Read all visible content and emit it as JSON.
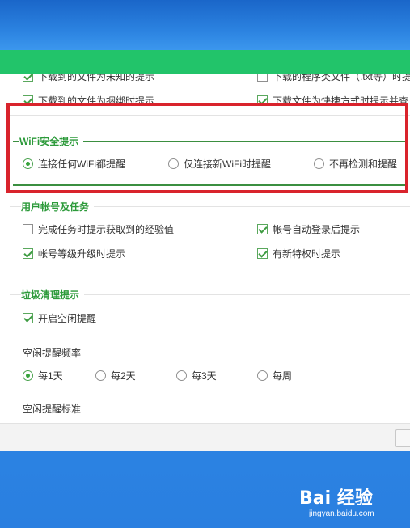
{
  "partial_rows": {
    "top_left": "下载到的文件为未知的提示",
    "top_right": "下载的程序类文件（.txt等）时提",
    "row2_left": "下载到的文件为捆绑时提示",
    "row2_right": "下载文件为快捷方式时提示并查"
  },
  "wifi": {
    "title": "WiFi安全提示",
    "options": [
      "连接任何WiFi都提醒",
      "仅连接新WiFi时提醒",
      "不再检测和提醒"
    ]
  },
  "account": {
    "title": "用户帐号及任务",
    "items": [
      "完成任务时提示获取到的经验值",
      "帐号自动登录后提示",
      "帐号等级升级时提示",
      "有新特权时提示"
    ]
  },
  "cleanup": {
    "title": "垃圾清理提示",
    "enable_label": "开启空闲提醒",
    "frequency_label": "空闲提醒频率",
    "frequency_options": [
      "每1天",
      "每2天",
      "每3天",
      "每周"
    ],
    "standard_label": "空闲提醒标准"
  },
  "watermark": {
    "logo": "Bai 经验",
    "url": "jingyan.baidu.com"
  },
  "colors": {
    "titlebar": "#22c46a",
    "accent_green": "#2c9a3a",
    "highlight_red": "#d9232c"
  }
}
